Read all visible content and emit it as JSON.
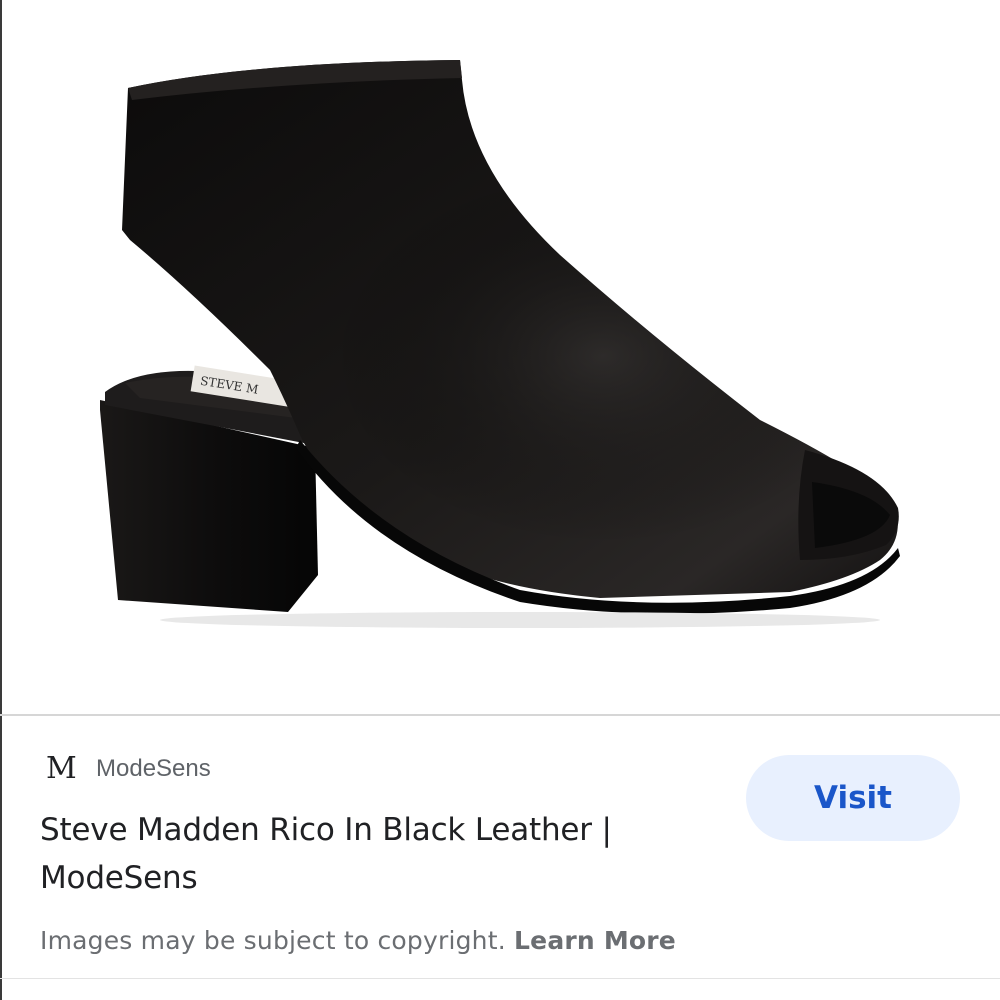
{
  "image": {
    "alt_icon": "product-image"
  },
  "source": {
    "logo_letter": "M",
    "name": "ModeSens"
  },
  "result": {
    "title_line1": "Steve Madden Rico In Black Leather |",
    "title_line2": "ModeSens"
  },
  "actions": {
    "visit_label": "Visit"
  },
  "footer": {
    "copyright_text": "Images may be subject to copyright.",
    "learn_more_label": "Learn More"
  },
  "insole_brand": "STEVE M",
  "colors": {
    "accent": "#1a56c9",
    "button_bg": "#e8f0fe",
    "shoe": "#141212"
  }
}
